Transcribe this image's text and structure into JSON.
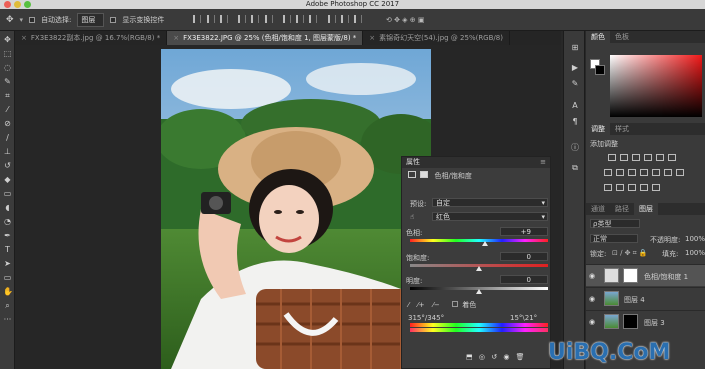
{
  "app": {
    "title": "Adobe Photoshop CC 2017"
  },
  "options_bar": {
    "auto_select_label": "自动选择:",
    "auto_select_value": "图层",
    "show_transform_label": "显示变换控件"
  },
  "tabs": [
    {
      "label": "FX3E3822副本.jpg @ 16.7%(RGB/8) *"
    },
    {
      "label": "FX3E3822.JPG @ 25% (色相/饱和度 1, 图层蒙版/8) *"
    },
    {
      "label": "素锦奇幻天空(54).jpg @ 25%(RGB/8)"
    }
  ],
  "properties": {
    "title": "属性",
    "subtitle": "色相/饱和度",
    "preset_label": "预设:",
    "preset_value": "自定",
    "channel_value": "红色",
    "hue_label": "色相:",
    "hue_value": "+9",
    "saturation_label": "饱和度:",
    "saturation_value": "0",
    "lightness_label": "明度:",
    "lightness_value": "0",
    "colorize_label": "着色",
    "range_left": "315°/345°",
    "range_right": "15°\\21°",
    "hue_level": 0.54,
    "saturation_level": 0.5,
    "lightness_level": 0.5
  },
  "right": {
    "color_tabs": [
      "颜色",
      "色板"
    ],
    "adjust_tabs": [
      "调整",
      "样式"
    ],
    "add_adjustment": "添加调整",
    "layer_tabs": [
      "通道",
      "路径",
      "图层"
    ],
    "kind_label": "ρ类型",
    "blend_mode": "正常",
    "opacity_label": "不透明度:",
    "opacity_value": "100%",
    "lock_label": "锁定:",
    "fill_label": "填充:",
    "fill_value": "100%",
    "layers": [
      {
        "name": "色相/饱和度 1"
      },
      {
        "name": "图层 4"
      },
      {
        "name": "图层 3"
      }
    ]
  },
  "watermark": "UiBQ.CoM",
  "colors": {
    "accent": "#2a6fb0",
    "panel": "#3a3a3a",
    "bg": "#282828"
  }
}
